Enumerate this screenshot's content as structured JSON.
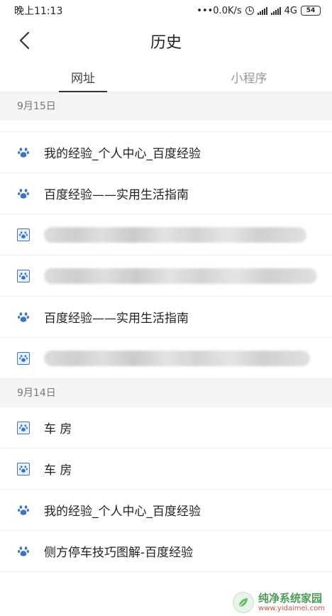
{
  "status_bar": {
    "time": "晚上11:13",
    "network_speed": "•••0.0K/s",
    "network_type": "4G",
    "battery": "54"
  },
  "header": {
    "title": "历史"
  },
  "tabs": [
    {
      "label": "网址",
      "active": true
    },
    {
      "label": "小程序",
      "active": false
    }
  ],
  "history": [
    {
      "date": "9月15日",
      "items": [
        {
          "title": "我的经验_个人中心_百度经验",
          "icon": "baidu-paw-icon",
          "blurred": false
        },
        {
          "title": "百度经验——实用生活指南",
          "icon": "baidu-paw-icon",
          "blurred": false
        },
        {
          "title": "",
          "icon": "baidu-paw-boxed-icon",
          "blurred": true
        },
        {
          "title": "",
          "icon": "baidu-paw-boxed-icon",
          "blurred": true
        },
        {
          "title": "百度经验——实用生活指南",
          "icon": "baidu-paw-icon",
          "blurred": false
        },
        {
          "title": "",
          "icon": "baidu-paw-boxed-icon",
          "blurred": true
        }
      ]
    },
    {
      "date": "9月14日",
      "items": [
        {
          "title": "车 房",
          "icon": "baidu-paw-boxed-icon",
          "blurred": false
        },
        {
          "title": "车 房",
          "icon": "baidu-paw-boxed-icon",
          "blurred": false
        },
        {
          "title": "我的经验_个人中心_百度经验",
          "icon": "baidu-paw-icon",
          "blurred": false
        },
        {
          "title": "侧方停车技巧图解-百度经验",
          "icon": "baidu-paw-icon",
          "blurred": false
        }
      ]
    }
  ],
  "watermark": {
    "name": "纯净系统家园",
    "url": "www.yidaimei.com"
  },
  "colors": {
    "paw_blue": "#3b73c8",
    "date_header_bg": "#f5f5f5",
    "text_primary": "#222222",
    "text_muted": "#999999"
  }
}
